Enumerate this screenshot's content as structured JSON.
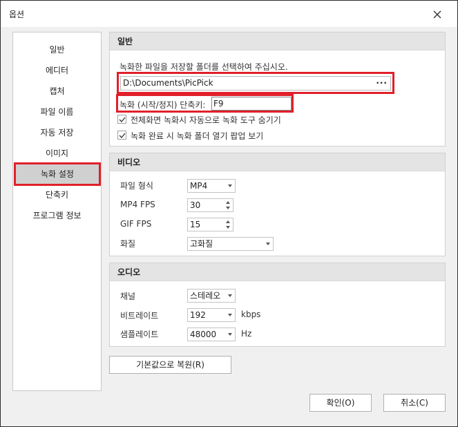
{
  "window": {
    "title": "옵션"
  },
  "sidebar": {
    "items": [
      {
        "label": "일반"
      },
      {
        "label": "에디터"
      },
      {
        "label": "캡처"
      },
      {
        "label": "파일 이름"
      },
      {
        "label": "자동 저장"
      },
      {
        "label": "이미지"
      },
      {
        "label": "녹화 설정",
        "selected": true
      },
      {
        "label": "단축키"
      },
      {
        "label": "프로그램 정보"
      }
    ]
  },
  "general": {
    "header": "일반",
    "folder_prompt": "녹화한 파일을 저장할 폴더를 선택하여 주십시오.",
    "folder_path": "D:\\Documents\\PicPick",
    "browse_label": "···",
    "hotkey_label": "녹화 (시작/정지) 단축키:",
    "hotkey_value": "F9",
    "check_fullscreen_autohide": {
      "label": "전체화면 녹화시 자동으로 녹화 도구 숨기기",
      "checked": true
    },
    "check_open_folder_popup": {
      "label": "녹화 완료 시 녹화 폴더 열기 팝업 보기",
      "checked": true
    }
  },
  "video": {
    "header": "비디오",
    "file_format_label": "파일 형식",
    "file_format_value": "MP4",
    "mp4_fps_label": "MP4 FPS",
    "mp4_fps_value": "30",
    "gif_fps_label": "GIF FPS",
    "gif_fps_value": "15",
    "quality_label": "화질",
    "quality_value": "고화질"
  },
  "audio": {
    "header": "오디오",
    "channel_label": "채널",
    "channel_value": "스테레오",
    "bitrate_label": "비트레이트",
    "bitrate_value": "192",
    "bitrate_unit": "kbps",
    "samplerate_label": "샘플레이트",
    "samplerate_value": "48000",
    "samplerate_unit": "Hz"
  },
  "buttons": {
    "reset": "기본값으로 복원(R)",
    "ok": "확인(O)",
    "cancel": "취소(C)"
  },
  "colors": {
    "highlight_border": "#e0202a",
    "selected_item_bg": "#d0d0d0",
    "group_header_bg": "#e4e4e4"
  }
}
